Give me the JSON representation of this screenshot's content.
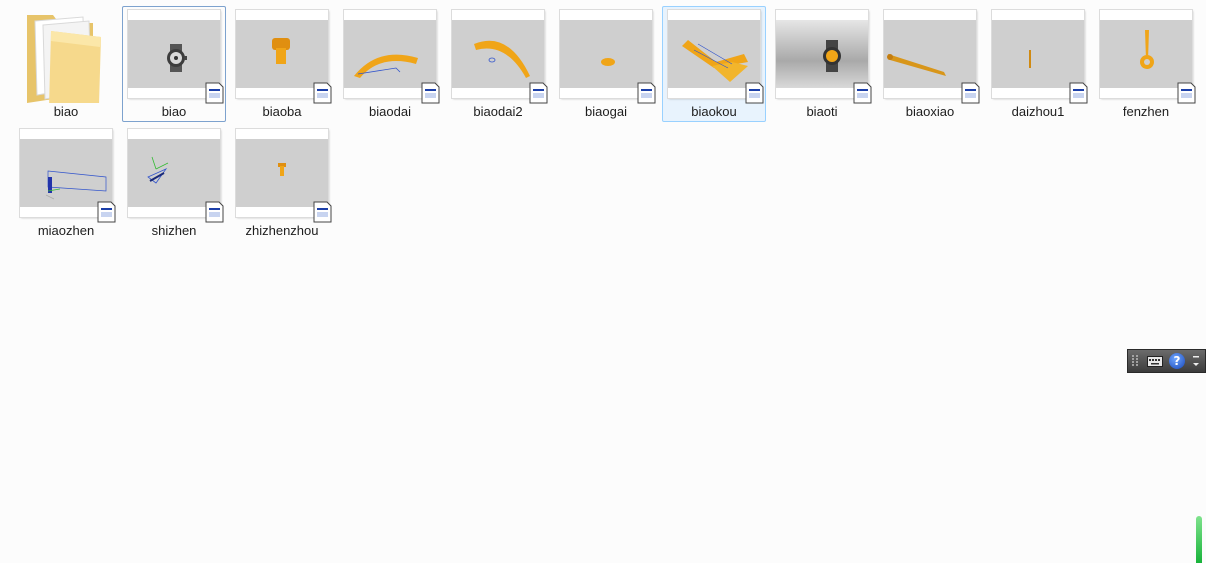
{
  "items": [
    {
      "name": "biao",
      "type": "folder"
    },
    {
      "name": "biao",
      "type": "part-file"
    },
    {
      "name": "biaoba",
      "type": "part-file"
    },
    {
      "name": "biaodai",
      "type": "part-file"
    },
    {
      "name": "biaodai2",
      "type": "part-file"
    },
    {
      "name": "biaogai",
      "type": "part-file"
    },
    {
      "name": "biaokou",
      "type": "part-file"
    },
    {
      "name": "biaoti",
      "type": "part-file"
    },
    {
      "name": "biaoxiao",
      "type": "part-file"
    },
    {
      "name": "daizhou1",
      "type": "part-file"
    },
    {
      "name": "fenzhen",
      "type": "part-file"
    },
    {
      "name": "miaozhen",
      "type": "part-file"
    },
    {
      "name": "shizhen",
      "type": "part-file"
    },
    {
      "name": "zhizhenzhou",
      "type": "part-file"
    }
  ],
  "selected_item": "biaokou",
  "focused_item": "biao",
  "colors": {
    "part_orange": "#f0a518",
    "viewport_gray": "#cfcfcf",
    "selection_fill": "#e8f3fd",
    "selection_border": "#99d1ff",
    "language_bar": "#4a4a4a"
  },
  "language_bar": {
    "icons": [
      "grip-icon",
      "keyboard-icon",
      "help-icon",
      "options-icon"
    ],
    "help_glyph": "?"
  }
}
